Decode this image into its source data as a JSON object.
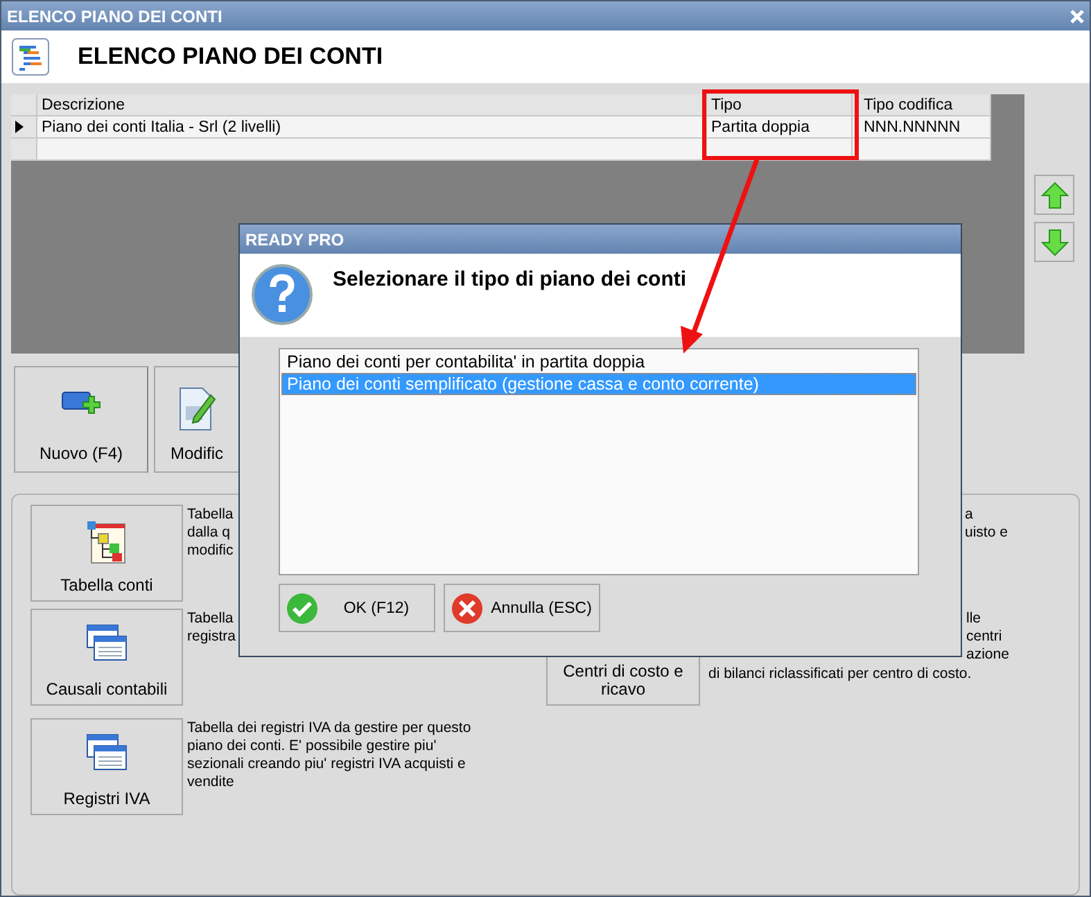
{
  "window": {
    "title": "ELENCO PIANO DEI CONTI",
    "heading": "ELENCO PIANO DEI CONTI"
  },
  "table": {
    "columns": [
      "Descrizione",
      "Tipo",
      "Tipo codifica"
    ],
    "rows": [
      {
        "cells": [
          "Piano dei conti Italia - Srl (2 livelli)",
          "Partita doppia",
          "NNN.NNNNN"
        ],
        "selected": true
      }
    ]
  },
  "actions": [
    {
      "label": "Nuovo (F4)"
    },
    {
      "label": "Modific"
    }
  ],
  "group_left": [
    {
      "label": "Tabella conti",
      "description": [
        "Tabella",
        "dalla q",
        "modific"
      ]
    },
    {
      "label": "Causali contabili",
      "description": [
        "Tabella",
        "registra"
      ]
    },
    {
      "label": "Registri IVA",
      "description": [
        "Tabella dei registri IVA da gestire per questo",
        "piano dei conti. E' possibile gestire piu'",
        "sezionali creando piu' registri IVA acquisti e",
        "vendite"
      ]
    }
  ],
  "group_right": [
    {
      "cut_lines": [
        "a",
        "uisto e"
      ]
    },
    {
      "label": [
        "Centri di costo e",
        "ricavo"
      ],
      "cut_lines": [
        "lle",
        "centri",
        "azione"
      ],
      "description": [
        "di bilanci riclassificati per centro di costo."
      ]
    }
  ],
  "dialog": {
    "title": "READY PRO",
    "message": "Selezionare il tipo di piano dei conti",
    "options": [
      {
        "label": "Piano dei conti per contabilita' in partita doppia",
        "selected": false
      },
      {
        "label": "Piano dei conti semplificato (gestione cassa e conto corrente)",
        "selected": true
      }
    ],
    "buttons": [
      {
        "label": "OK (F12)",
        "kind": "ok"
      },
      {
        "label": "Annulla (ESC)",
        "kind": "cancel"
      }
    ]
  }
}
